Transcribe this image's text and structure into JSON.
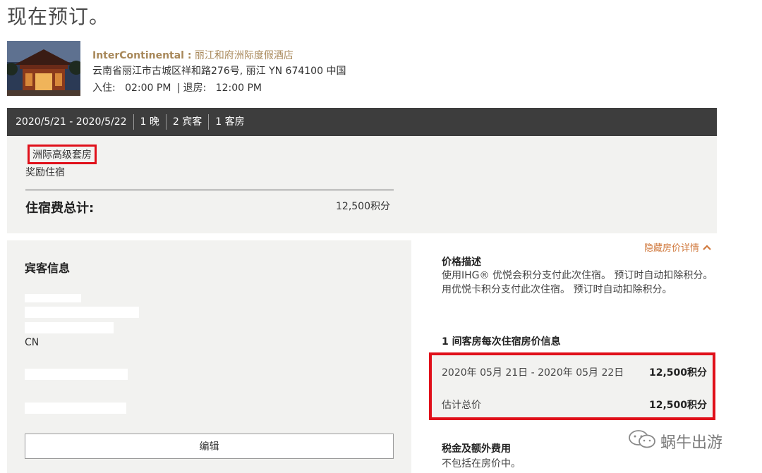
{
  "page": {
    "title": "现在预订。"
  },
  "hotel": {
    "brand": "InterContinental :",
    "name": " 丽江和府洲际度假酒店",
    "address": "云南省丽江市古城区祥和路276号, 丽江 YN 674100 中国",
    "checkin_label": "入住:",
    "checkin_time": "02:00 PM",
    "separator": "|",
    "checkout_label": "退房:",
    "checkout_time": "12:00 PM"
  },
  "stay": {
    "dates": "2020/5/21 - 2020/5/22",
    "nights": "1 晚",
    "guests": "2 宾客",
    "rooms": "1 客房"
  },
  "summary": {
    "room_type": "洲际高级套房",
    "rate_type": "奖励住宿",
    "total_label": "住宿费总计:",
    "total_value": "12,500积分"
  },
  "guest": {
    "heading": "宾客信息",
    "country": "CN",
    "edit_label": "编辑"
  },
  "price": {
    "toggle_label": "隐藏房价详情",
    "desc_heading": "价格描述",
    "desc_text": "使用IHG® 优悦会积分支付此次住宿。 预订时自动扣除积分。 用优悦卡积分支付此次住宿。 预订时自动扣除积分。",
    "nightly_heading": "1 间客房每次住宿房价信息",
    "nightly_dates": "2020年 05月 21日 - 2020年 05月 22日",
    "nightly_value": "12,500积分",
    "estimate_label": "估计总价",
    "estimate_value": "12,500积分",
    "tax_heading": "税金及额外费用",
    "tax_text": "不包括在房价中。"
  },
  "watermark": {
    "text": "蜗牛出游"
  },
  "colors": {
    "accent_gold": "#a8885a",
    "link_orange": "#d0783c",
    "highlight_red": "#e0101a",
    "bar_dark": "#3d3d3d",
    "panel_gray": "#f2f2f0"
  }
}
